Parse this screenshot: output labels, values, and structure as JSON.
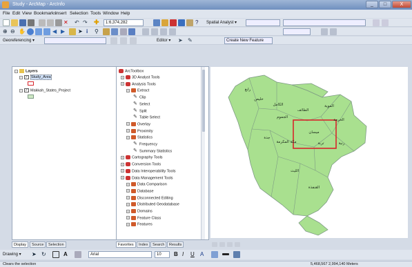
{
  "window": {
    "title": "Study - ArcMap - ArcInfo",
    "min": "_",
    "max": "□",
    "close": "X"
  },
  "menu": [
    "File",
    "Edit",
    "View",
    "Bookmarks",
    "Insert",
    "Selection",
    "Tools",
    "Window",
    "Help"
  ],
  "toolbar1": {
    "scale": "1:6,374,282",
    "spatial_analyst": "Spatial Analyst ▾",
    "layer_combo": "",
    "editor": ""
  },
  "toolbar3": {
    "georeferencing": "Georeferencing ▾",
    "layer_combo": "",
    "editor": "Editor ▾",
    "sketch": "Create New Feature"
  },
  "toc": {
    "root": "Layers",
    "layers": [
      {
        "label": "Study_Area",
        "checked": true
      },
      {
        "label": "Makkah_States_Project",
        "checked": true
      }
    ],
    "tabs": [
      "Display",
      "Source",
      "Selection"
    ]
  },
  "toolbox": {
    "root": "ArcToolbox",
    "items": [
      {
        "label": "3D Analyst Tools",
        "level": 1,
        "icon": "toolbox"
      },
      {
        "label": "Analysis Tools",
        "level": 1,
        "icon": "toolbox"
      },
      {
        "label": "Extract",
        "level": 2,
        "icon": "toolset"
      },
      {
        "label": "Clip",
        "level": 3,
        "icon": "tool"
      },
      {
        "label": "Select",
        "level": 3,
        "icon": "tool"
      },
      {
        "label": "Split",
        "level": 3,
        "icon": "tool"
      },
      {
        "label": "Table Select",
        "level": 3,
        "icon": "tool"
      },
      {
        "label": "Overlay",
        "level": 2,
        "icon": "toolset"
      },
      {
        "label": "Proximity",
        "level": 2,
        "icon": "toolset"
      },
      {
        "label": "Statistics",
        "level": 2,
        "icon": "toolset"
      },
      {
        "label": "Frequency",
        "level": 3,
        "icon": "tool"
      },
      {
        "label": "Summary Statistics",
        "level": 3,
        "icon": "tool"
      },
      {
        "label": "Cartography Tools",
        "level": 1,
        "icon": "toolbox"
      },
      {
        "label": "Conversion Tools",
        "level": 1,
        "icon": "toolbox"
      },
      {
        "label": "Data Interoperability Tools",
        "level": 1,
        "icon": "toolbox"
      },
      {
        "label": "Data Management Tools",
        "level": 1,
        "icon": "toolbox"
      },
      {
        "label": "Data Comparison",
        "level": 2,
        "icon": "toolset"
      },
      {
        "label": "Database",
        "level": 2,
        "icon": "toolset"
      },
      {
        "label": "Disconnected Editing",
        "level": 2,
        "icon": "toolset"
      },
      {
        "label": "Distributed Geodatabase",
        "level": 2,
        "icon": "toolset"
      },
      {
        "label": "Domains",
        "level": 2,
        "icon": "toolset"
      },
      {
        "label": "Feature Class",
        "level": 2,
        "icon": "toolset"
      },
      {
        "label": "Features",
        "level": 2,
        "icon": "toolset"
      }
    ],
    "tabs": [
      "Favorites",
      "Index",
      "Search",
      "Results"
    ]
  },
  "map": {
    "fill_color": "#a9e08f",
    "stroke_color": "#7d9a84",
    "box_color": "#d8242a",
    "labels": [
      "رابغ",
      "خليص",
      "الجموم",
      "الكامل",
      "الطائف",
      "مكة المكرمة",
      "جدة",
      "الخرمة",
      "رنية",
      "الليث",
      "القنفذة",
      "تربة",
      "الموية",
      "ميسان"
    ]
  },
  "drawing": {
    "label": "Drawing ▾",
    "font": "Arial",
    "size": "10"
  },
  "status": {
    "left": "Clears the selection",
    "right": "5,468,567  2,994,140 Meters"
  },
  "colors": {
    "title_bar": "#6f8fbf",
    "chrome": "#dfe5ee",
    "panel_bg": "#ffffff"
  }
}
